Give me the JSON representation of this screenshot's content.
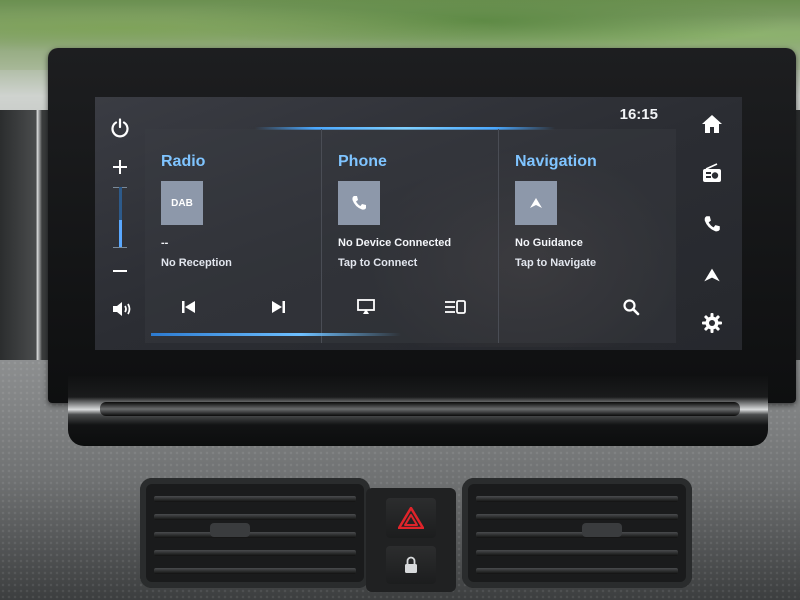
{
  "status": {
    "time": "16:15"
  },
  "left_rail": {
    "power_icon": "power-icon",
    "volume_up_icon": "plus-icon",
    "volume_down_icon": "minus-icon",
    "speaker_icon": "speaker-icon",
    "volume_level": 0.45
  },
  "right_rail": {
    "items": [
      {
        "name": "home-icon"
      },
      {
        "name": "radio-icon"
      },
      {
        "name": "phone-icon"
      },
      {
        "name": "navigation-icon"
      },
      {
        "name": "settings-icon"
      }
    ]
  },
  "cards": {
    "radio": {
      "title": "Radio",
      "tile_label": "DAB",
      "line1": "--",
      "line2": "No Reception",
      "controls": [
        "previous-track-icon",
        "next-track-icon"
      ]
    },
    "phone": {
      "title": "Phone",
      "line1": "No Device Connected",
      "line2": "Tap to Connect",
      "controls": [
        "screen-mirror-icon",
        "list-icon"
      ]
    },
    "navigation": {
      "title": "Navigation",
      "line1": "No Guidance",
      "line2": "Tap to Navigate",
      "controls": [
        "search-icon"
      ]
    }
  },
  "colors": {
    "accent": "#7fc4ff",
    "background": "#2b2d33",
    "tile": "#8d98aa",
    "hazard": "#e0242a"
  }
}
